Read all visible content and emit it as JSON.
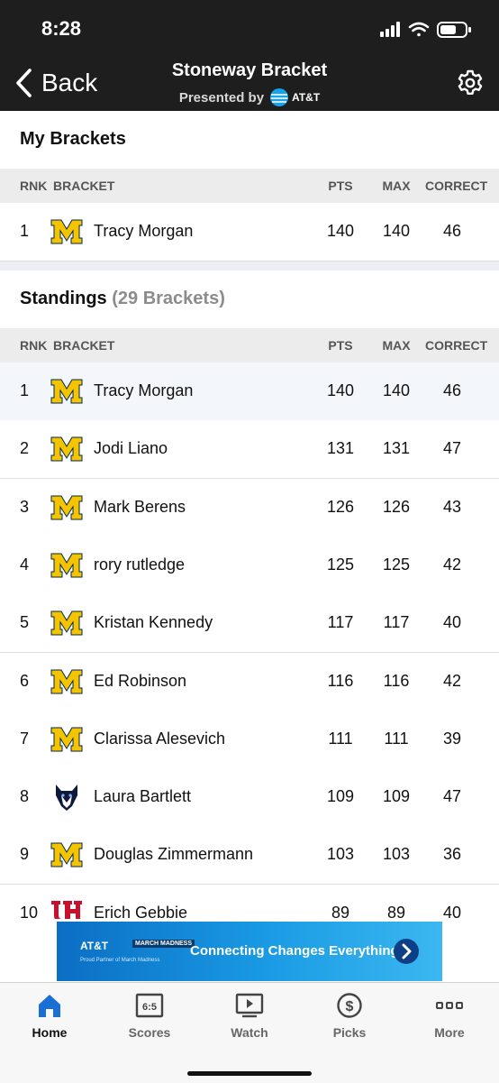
{
  "status": {
    "time": "8:28"
  },
  "nav": {
    "back_label": "Back",
    "title": "Stoneway  Bracket",
    "presented_by": "Presented by",
    "sponsor": "AT&T"
  },
  "my_brackets": {
    "title": "My Brackets",
    "columns": {
      "rnk": "RNK",
      "bracket": "BRACKET",
      "pts": "PTS",
      "max": "MAX",
      "correct": "CORRECT"
    },
    "rows": [
      {
        "rnk": "1",
        "logo": "michigan-logo-icon",
        "name": "Tracy  Morgan",
        "pts": "140",
        "max": "140",
        "correct": "46"
      }
    ]
  },
  "standings": {
    "title": "Standings",
    "count": "(29 Brackets)",
    "columns": {
      "rnk": "RNK",
      "bracket": "BRACKET",
      "pts": "PTS",
      "max": "MAX",
      "correct": "CORRECT"
    },
    "rows": [
      {
        "rnk": "1",
        "logo": "michigan-logo-icon",
        "name": "Tracy  Morgan",
        "pts": "140",
        "max": "140",
        "correct": "46"
      },
      {
        "rnk": "2",
        "logo": "michigan-logo-icon",
        "name": "Jodi Liano",
        "pts": "131",
        "max": "131",
        "correct": "47"
      },
      {
        "rnk": "3",
        "logo": "michigan-logo-icon",
        "name": "Mark Berens",
        "pts": "126",
        "max": "126",
        "correct": "43"
      },
      {
        "rnk": "4",
        "logo": "michigan-logo-icon",
        "name": "rory rutledge",
        "pts": "125",
        "max": "125",
        "correct": "42"
      },
      {
        "rnk": "5",
        "logo": "michigan-logo-icon",
        "name": "Kristan Kennedy",
        "pts": "117",
        "max": "117",
        "correct": "40"
      },
      {
        "rnk": "6",
        "logo": "michigan-logo-icon",
        "name": "Ed Robinson",
        "pts": "116",
        "max": "116",
        "correct": "42"
      },
      {
        "rnk": "7",
        "logo": "michigan-logo-icon",
        "name": "Clarissa Alesevich",
        "pts": "111",
        "max": "111",
        "correct": "39"
      },
      {
        "rnk": "8",
        "logo": "uconn-husky-logo-icon",
        "name": "Laura Bartlett",
        "pts": "109",
        "max": "109",
        "correct": "47"
      },
      {
        "rnk": "9",
        "logo": "michigan-logo-icon",
        "name": "Douglas Zimmermann",
        "pts": "103",
        "max": "103",
        "correct": "36"
      },
      {
        "rnk": "10",
        "logo": "houston-uh-logo-icon",
        "name": "Erich Gebbie",
        "pts": "89",
        "max": "89",
        "correct": "40"
      }
    ]
  },
  "ad": {
    "brand": "AT&T",
    "badge": "MARCH MADNESS",
    "subline": "Proud Partner of March Madness",
    "headline": "Connecting Changes Everything"
  },
  "tabs": [
    {
      "label": "Home",
      "icon": "home-icon",
      "active": true
    },
    {
      "label": "Scores",
      "icon": "scores-icon",
      "active": false
    },
    {
      "label": "Watch",
      "icon": "watch-icon",
      "active": false
    },
    {
      "label": "Picks",
      "icon": "picks-icon",
      "active": false
    },
    {
      "label": "More",
      "icon": "more-icon",
      "active": false
    }
  ],
  "colors": {
    "header_bg": "#1e1e1e",
    "michigan_maize": "#f5c400",
    "michigan_blue": "#00274c",
    "houston_red": "#c8102e",
    "tab_active": "#1a6fd6"
  }
}
